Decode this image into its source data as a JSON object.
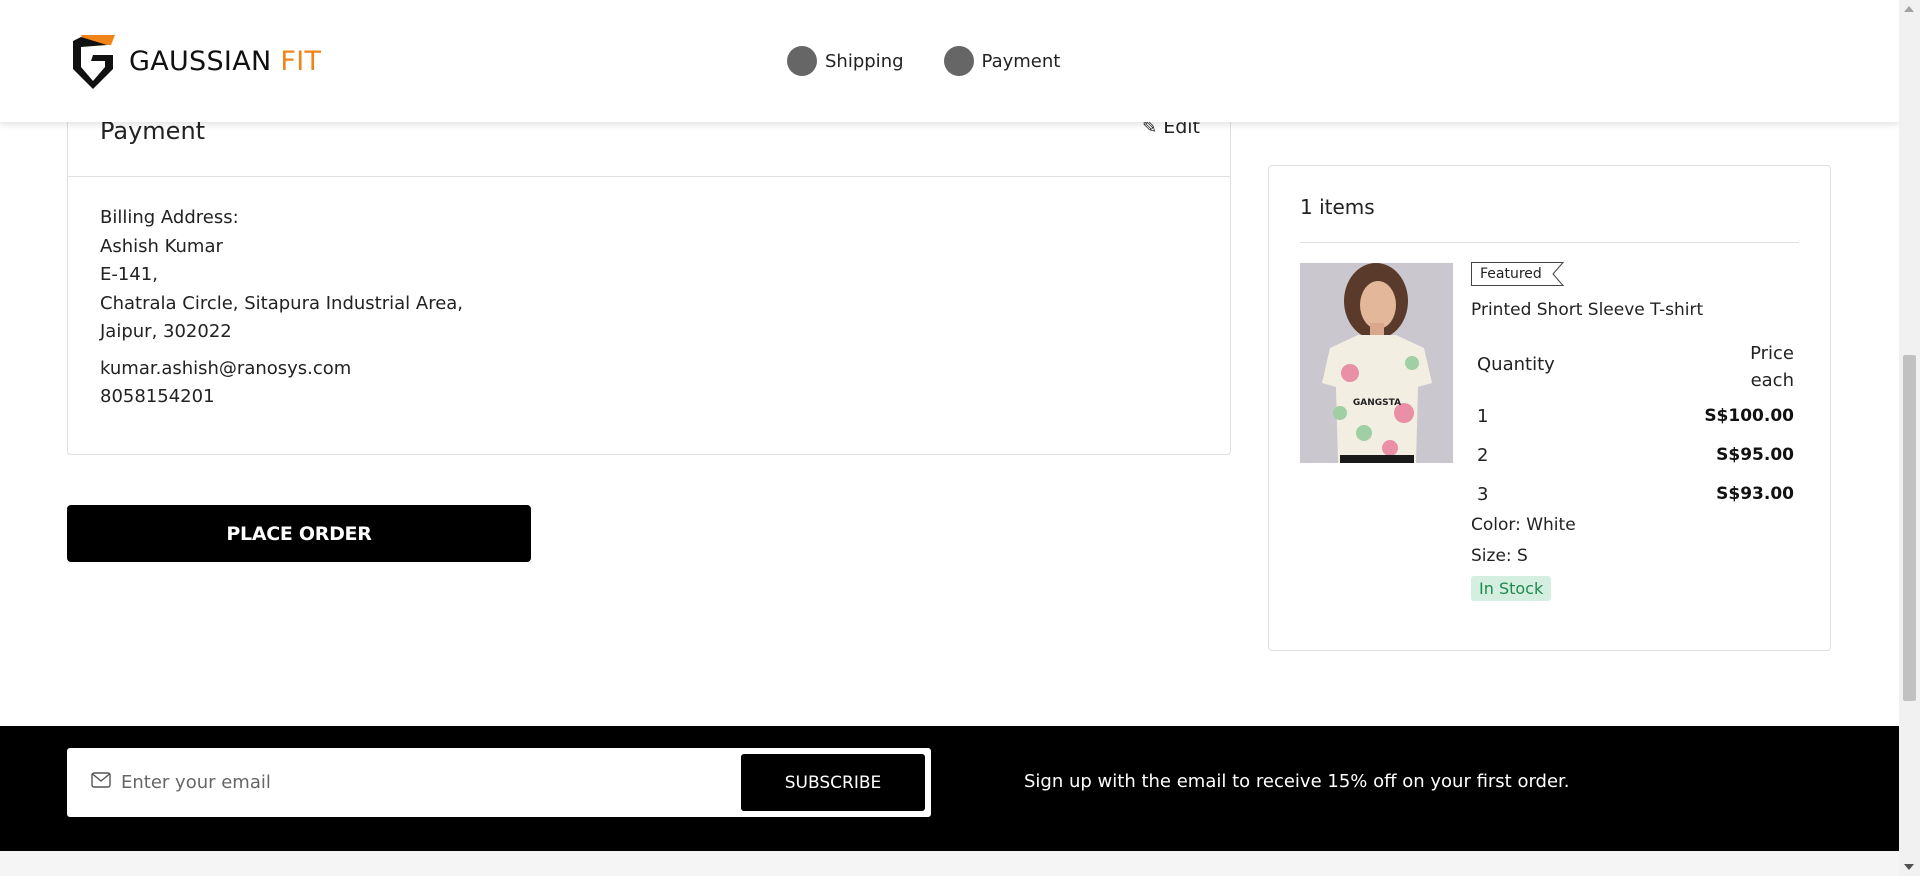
{
  "header": {
    "logo_main": "GAUSSIAN ",
    "logo_accent": "FIT",
    "steps": [
      {
        "label": "Shipping"
      },
      {
        "label": "Payment"
      }
    ]
  },
  "payment": {
    "title": "Payment",
    "edit_label": "Edit",
    "billing_heading": "Billing Address:",
    "name": "Ashish Kumar",
    "line1": "E-141,",
    "line2": "Chatrala Circle, Sitapura Industrial Area,",
    "line3": "Jaipur, 302022",
    "email": "kumar.ashish@ranosys.com",
    "phone": "8058154201"
  },
  "place_order_label": "PLACE ORDER",
  "summary": {
    "items_count": "1 items",
    "badge": "Featured",
    "product_name": "Printed Short Sleeve T-shirt",
    "qty_header": "Quantity",
    "price_header_line1": "Price",
    "price_header_line2": "each",
    "tiers": [
      {
        "qty": "1",
        "price": "S$100.00"
      },
      {
        "qty": "2",
        "price": "S$95.00"
      },
      {
        "qty": "3",
        "price": "S$93.00"
      }
    ],
    "color": "Color: White",
    "size": "Size: S",
    "stock": "In Stock",
    "shirt_print": "GANGSTA"
  },
  "footer": {
    "email_placeholder": "Enter your email",
    "subscribe_label": "SUBSCRIBE",
    "promo_text": "Sign up with the email to receive 15% off on your first order."
  },
  "colors": {
    "accent": "#f08418",
    "in_stock_bg": "#d4efdf",
    "in_stock_text": "#1e8a4c"
  }
}
